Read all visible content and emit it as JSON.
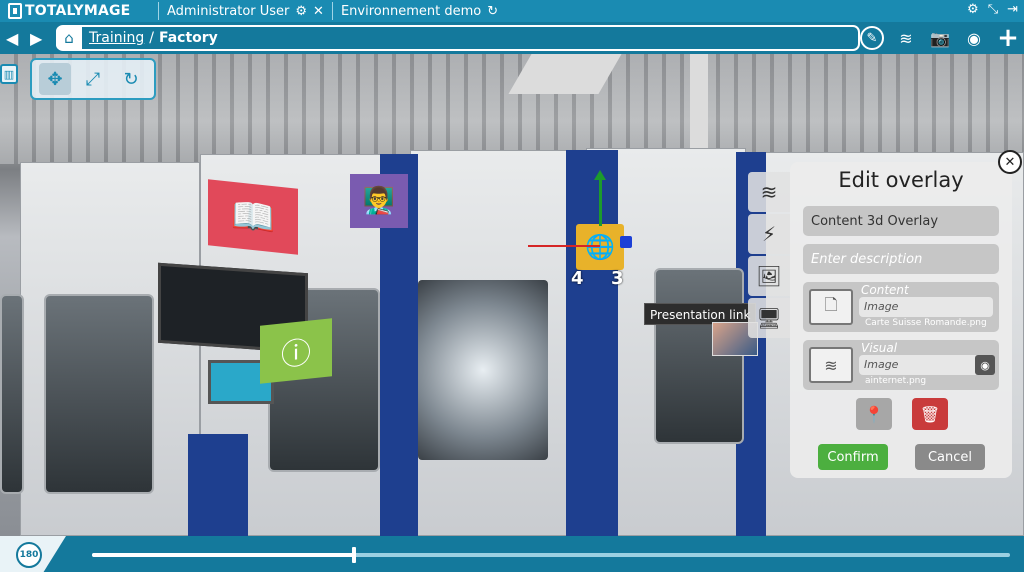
{
  "app": {
    "logo_text": "TOTALYMAGE",
    "user": "Administrator User",
    "environment": "Environnement demo"
  },
  "nav": {
    "breadcrumb": [
      {
        "label": "Training",
        "link": true
      },
      {
        "label": "Factory",
        "link": false
      }
    ],
    "separator": "/"
  },
  "scene": {
    "overlays": [
      {
        "kind": "book",
        "icon": "book-icon",
        "color": "#e1495a"
      },
      {
        "kind": "presentation",
        "icon": "presenter-icon",
        "color": "#7a5bb0"
      },
      {
        "kind": "info",
        "icon": "info-icon",
        "color": "#8bc34a"
      },
      {
        "kind": "link",
        "icon": "link-icon",
        "color": "#e8b22a"
      }
    ],
    "gizmo_labels": [
      "4",
      "3"
    ],
    "tooltip": "Presentation link"
  },
  "panel": {
    "title": "Edit overlay",
    "name_value": "Content 3d Overlay",
    "description_placeholder": "Enter description",
    "content": {
      "label": "Content",
      "type": "Image",
      "file": "Carte Suisse Romande.png"
    },
    "visual": {
      "label": "Visual",
      "type": "Image",
      "file": "ainternet.png"
    },
    "confirm_label": "Confirm",
    "cancel_label": "Cancel"
  },
  "timeline": {
    "degree_label": "180",
    "progress": 0.285
  },
  "colors": {
    "brand": "#1a8bb2",
    "confirm": "#4caf3f",
    "delete": "#c93b3b"
  }
}
